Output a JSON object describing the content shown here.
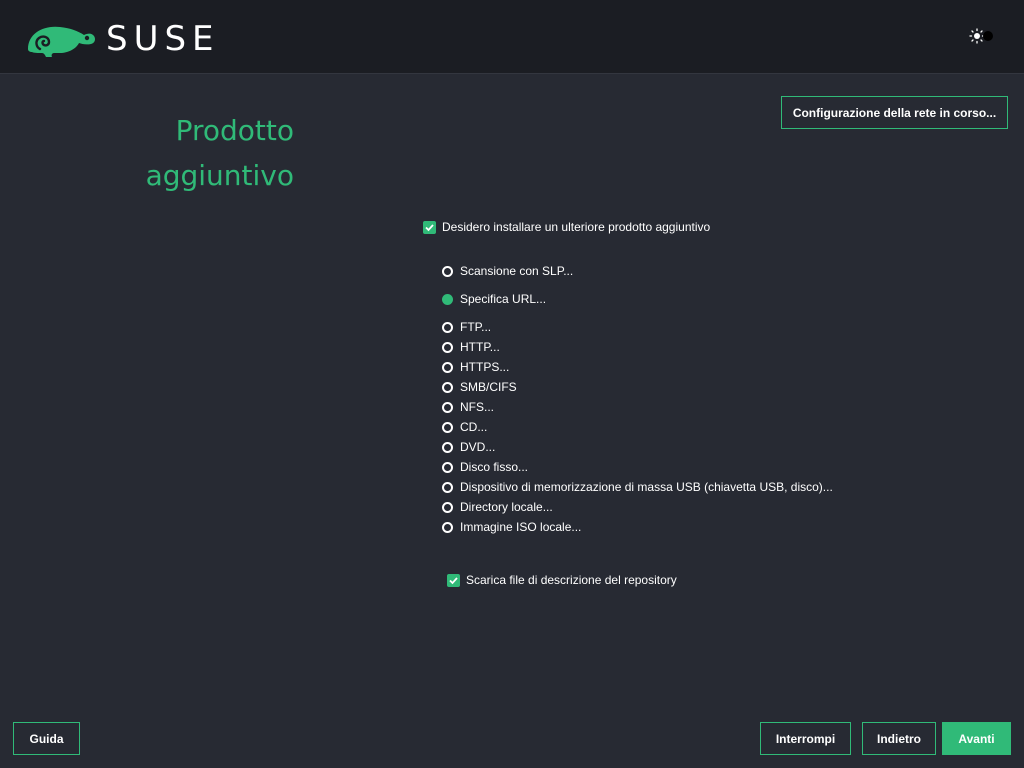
{
  "header": {
    "brand": "SUSE",
    "theme_toggle_icon": "sun-icon"
  },
  "page": {
    "title_line1": "Prodotto",
    "title_line2": "aggiuntivo"
  },
  "network_button": "Configurazione della rete in corso...",
  "main_checkbox": {
    "label": "Desidero installare un ulteriore prodotto aggiuntivo",
    "checked": true
  },
  "radio_options": [
    {
      "label": "Scansione con SLP...",
      "selected": false
    },
    {
      "label": "Specifica URL...",
      "selected": true
    },
    {
      "label": "FTP...",
      "selected": false
    },
    {
      "label": "HTTP...",
      "selected": false
    },
    {
      "label": "HTTPS...",
      "selected": false
    },
    {
      "label": "SMB/CIFS",
      "selected": false
    },
    {
      "label": "NFS...",
      "selected": false
    },
    {
      "label": "CD...",
      "selected": false
    },
    {
      "label": "DVD...",
      "selected": false
    },
    {
      "label": "Disco fisso...",
      "selected": false
    },
    {
      "label": "Dispositivo di memorizzazione di massa USB (chiavetta USB, disco)...",
      "selected": false
    },
    {
      "label": "Directory locale...",
      "selected": false
    },
    {
      "label": "Immagine ISO locale...",
      "selected": false
    }
  ],
  "download_checkbox": {
    "label": "Scarica file di descrizione del repository",
    "checked": true
  },
  "footer": {
    "help": "Guida",
    "abort": "Interrompi",
    "back": "Indietro",
    "next": "Avanti"
  },
  "colors": {
    "accent": "#30ba78",
    "background": "#272a33",
    "header_bg": "#1b1d23"
  }
}
